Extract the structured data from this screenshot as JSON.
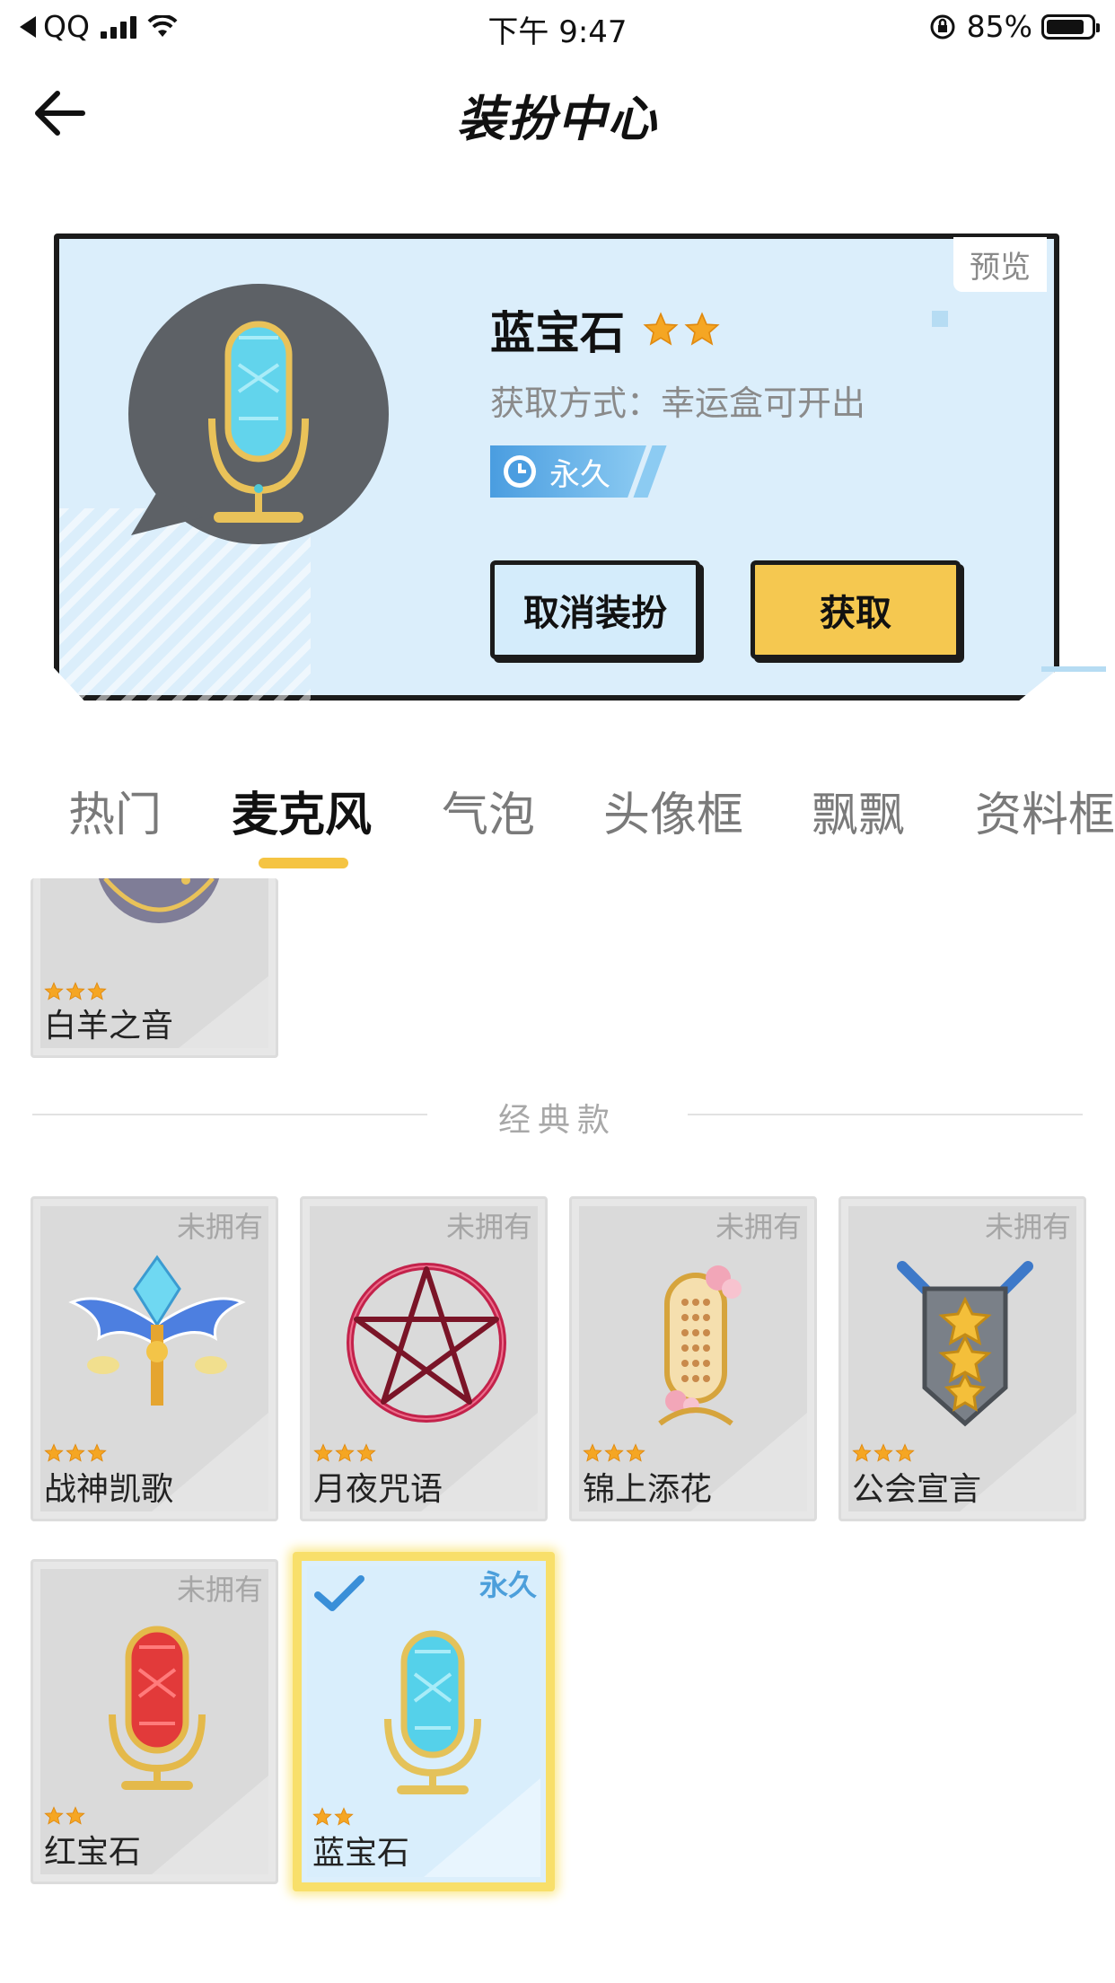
{
  "status_bar": {
    "carrier": "QQ",
    "time": "下午 9:47",
    "battery": "85%",
    "battery_level": 0.85
  },
  "header": {
    "title": "装扮中心"
  },
  "preview": {
    "tag": "预览",
    "name": "蓝宝石",
    "star_count": 2,
    "method": "获取方式：幸运盒可开出",
    "duration": "永久",
    "cancel_label": "取消装扮",
    "get_label": "获取"
  },
  "tabs": [
    "热门",
    "麦克风",
    "气泡",
    "头像框",
    "飘飘",
    "资料框"
  ],
  "active_tab": 1,
  "top_item": {
    "name": "白羊之音",
    "star_count": 3
  },
  "section": {
    "label": "经典款"
  },
  "items": [
    {
      "name": "战神凯歌",
      "status": "未拥有",
      "star_count": 3,
      "icon": "winged-scepter-icon"
    },
    {
      "name": "月夜咒语",
      "status": "未拥有",
      "star_count": 3,
      "icon": "pentagram-icon"
    },
    {
      "name": "锦上添花",
      "status": "未拥有",
      "star_count": 3,
      "icon": "flower-mic-icon"
    },
    {
      "name": "公会宣言",
      "status": "未拥有",
      "star_count": 3,
      "icon": "shield-swords-icon"
    },
    {
      "name": "红宝石",
      "status": "未拥有",
      "star_count": 2,
      "icon": "ruby-mic-icon"
    },
    {
      "name": "蓝宝石",
      "status": "永久",
      "star_count": 2,
      "icon": "sapphire-mic-icon",
      "selected": true
    }
  ],
  "colors": {
    "accent_yellow": "#f5c850",
    "preview_bg": "#dbeefb",
    "selected_blue": "#4c9fdb"
  }
}
